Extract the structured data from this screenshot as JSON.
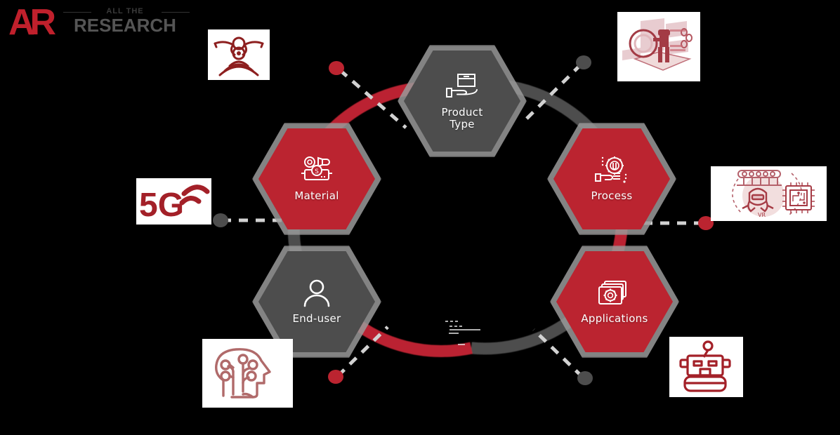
{
  "brand": {
    "monogram": "AR",
    "tagline": "ALL THE",
    "name": "RESEARCH",
    "red": "#c0202c",
    "gray": "#555555"
  },
  "diagram": {
    "type": "hexagon-ring-segmentation",
    "ring": {
      "segment_colors": [
        "#bb2430",
        "#4d4d4d"
      ],
      "segments": [
        {
          "from": "Material",
          "to": "Product Type",
          "color": "#bb2430"
        },
        {
          "from": "Product Type",
          "to": "Process",
          "color": "#4d4d4d"
        },
        {
          "from": "Process",
          "to": "Applications",
          "color": "#bb2430"
        },
        {
          "from": "Applications",
          "to": "End-user",
          "color": "#4d4d4d"
        },
        {
          "from": "End-user",
          "to": "Material-bottom",
          "color": "#bb2430"
        },
        {
          "from": "End-user",
          "to": "Material",
          "color": "#4d4d4d"
        }
      ]
    },
    "nodes": [
      {
        "id": "product-type",
        "label": "Product\nType",
        "label_line1": "Product",
        "label_line2": "Type",
        "color": "gray",
        "icon": "hand-holding-box-icon"
      },
      {
        "id": "process",
        "label": "Process",
        "label_line1": "Process",
        "label_line2": "",
        "color": "red",
        "icon": "hand-holding-gear-icon"
      },
      {
        "id": "applications",
        "label": "Applications",
        "label_line1": "Applications",
        "label_line2": "",
        "color": "red",
        "icon": "windows-gear-icon"
      },
      {
        "id": "end-user",
        "label": "End-user",
        "label_line1": "End-user",
        "label_line2": "",
        "color": "gray",
        "icon": "person-icon"
      },
      {
        "id": "material",
        "label": "Material",
        "label_line1": "Material",
        "label_line2": "",
        "color": "red",
        "icon": "materials-dollar-icon"
      }
    ],
    "connectors": [
      {
        "id": "connector-drone",
        "dot_color": "#bb2430",
        "style": "dashed",
        "target": "thumb-drone"
      },
      {
        "id": "connector-vr-person",
        "dot_color": "#4d4d4d",
        "style": "dashed",
        "target": "thumb-vr-person"
      },
      {
        "id": "connector-chip",
        "dot_color": "#bb2430",
        "style": "dashed",
        "target": "thumb-vr-chip"
      },
      {
        "id": "connector-robot",
        "dot_color": "#4d4d4d",
        "style": "dashed",
        "target": "thumb-robot"
      },
      {
        "id": "connector-ai-brain",
        "dot_color": "#bb2430",
        "style": "dashed",
        "target": "thumb-ai-brain"
      },
      {
        "id": "connector-5g",
        "dot_color": "#4d4d4d",
        "style": "dashed",
        "target": "thumb-5g"
      }
    ],
    "thumbnails": [
      {
        "id": "thumb-drone",
        "icon": "drone-signal-icon",
        "caption": ""
      },
      {
        "id": "thumb-vr-person",
        "icon": "vr-person-magnifier-icon",
        "caption": ""
      },
      {
        "id": "thumb-5g",
        "icon": "5g-signal-icon",
        "caption": "5G"
      },
      {
        "id": "thumb-vr-chip",
        "icon": "vr-headset-chip-icon",
        "caption": "VR"
      },
      {
        "id": "thumb-ai-brain",
        "icon": "ai-brain-head-icon",
        "caption": ""
      },
      {
        "id": "thumb-robot",
        "icon": "robot-icon",
        "caption": ""
      }
    ]
  }
}
